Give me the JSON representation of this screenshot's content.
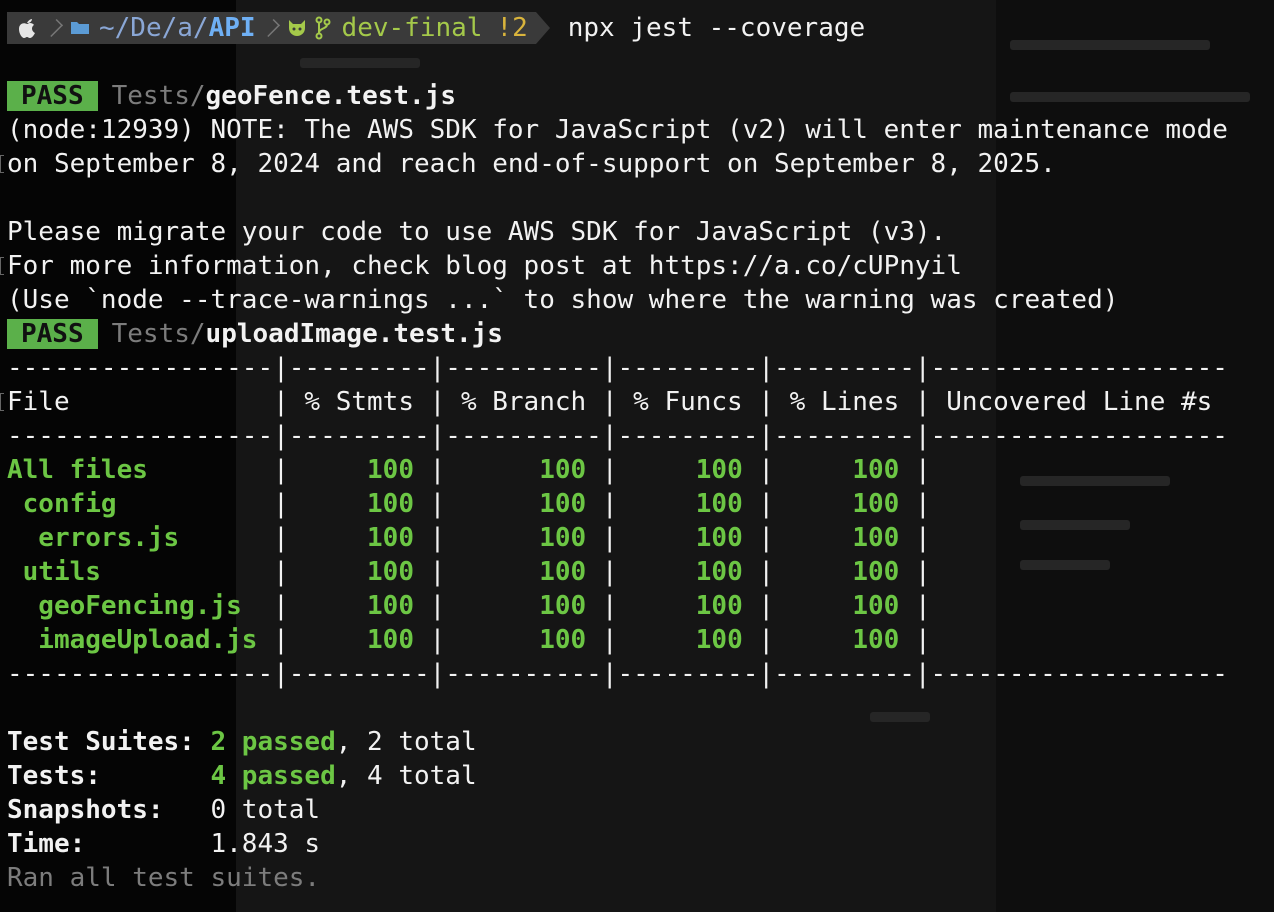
{
  "prompt": {
    "path_prefix": "~/De/a/",
    "path_dir": "API",
    "branch": "dev-final",
    "dirty": "!2",
    "command": "npx jest --coverage"
  },
  "suite1": {
    "badge": "PASS",
    "dir": "Tests/",
    "file": "geoFence.test.js"
  },
  "warning": [
    "(node:12939) NOTE: The AWS SDK for JavaScript (v2) will enter maintenance mode",
    "on September 8, 2024 and reach end-of-support on September 8, 2025.",
    "",
    "Please migrate your code to use AWS SDK for JavaScript (v3).",
    "For more information, check blog post at https://a.co/cUPnyil",
    "(Use `node --trace-warnings ...` to show where the warning was created)"
  ],
  "suite2": {
    "badge": "PASS",
    "dir": "Tests/",
    "file": "uploadImage.test.js"
  },
  "coverage": {
    "separator": "-----------------|---------|----------|---------|---------|-------------------",
    "header": "File             | % Stmts | % Branch | % Funcs | % Lines | Uncovered Line #s ",
    "rows": [
      {
        "name": "All files",
        "stmts": "100",
        "branch": "100",
        "funcs": "100",
        "lines": "100"
      },
      {
        "name": " config",
        "stmts": "100",
        "branch": "100",
        "funcs": "100",
        "lines": "100"
      },
      {
        "name": "  errors.js",
        "stmts": "100",
        "branch": "100",
        "funcs": "100",
        "lines": "100"
      },
      {
        "name": " utils",
        "stmts": "100",
        "branch": "100",
        "funcs": "100",
        "lines": "100"
      },
      {
        "name": "  geoFencing.js",
        "stmts": "100",
        "branch": "100",
        "funcs": "100",
        "lines": "100"
      },
      {
        "name": "  imageUpload.js",
        "stmts": "100",
        "branch": "100",
        "funcs": "100",
        "lines": "100"
      }
    ]
  },
  "summary": [
    {
      "label": "Test Suites: ",
      "passed": "2 passed",
      "rest": ", 2 total"
    },
    {
      "label": "Tests:       ",
      "passed": "4 passed",
      "rest": ", 4 total"
    },
    {
      "label": "Snapshots:   ",
      "passed": "",
      "rest": "0 total"
    },
    {
      "label": "Time:        ",
      "passed": "",
      "rest": "1.843 s"
    }
  ],
  "footer": "Ran all test suites.",
  "colors": {
    "pass_bg": "#5bb04a",
    "green": "#6cc644",
    "path": "#6fb0f5",
    "branch": "#a4c94a",
    "dirty": "#d9b43c"
  }
}
